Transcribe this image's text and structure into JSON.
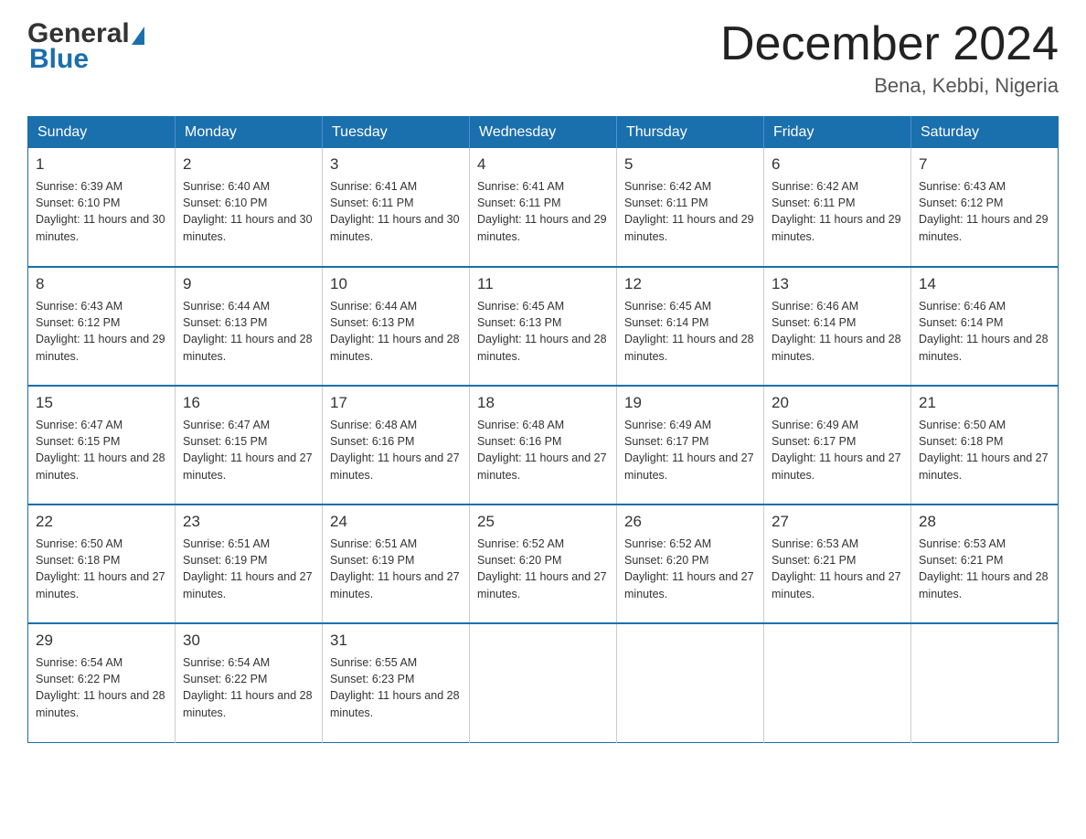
{
  "logo": {
    "general": "General",
    "blue": "Blue",
    "triangle": "▶"
  },
  "header": {
    "title": "December 2024",
    "subtitle": "Bena, Kebbi, Nigeria"
  },
  "weekdays": [
    "Sunday",
    "Monday",
    "Tuesday",
    "Wednesday",
    "Thursday",
    "Friday",
    "Saturday"
  ],
  "weeks": [
    [
      {
        "day": 1,
        "sunrise": "6:39 AM",
        "sunset": "6:10 PM",
        "daylight": "11 hours and 30 minutes."
      },
      {
        "day": 2,
        "sunrise": "6:40 AM",
        "sunset": "6:10 PM",
        "daylight": "11 hours and 30 minutes."
      },
      {
        "day": 3,
        "sunrise": "6:41 AM",
        "sunset": "6:11 PM",
        "daylight": "11 hours and 30 minutes."
      },
      {
        "day": 4,
        "sunrise": "6:41 AM",
        "sunset": "6:11 PM",
        "daylight": "11 hours and 29 minutes."
      },
      {
        "day": 5,
        "sunrise": "6:42 AM",
        "sunset": "6:11 PM",
        "daylight": "11 hours and 29 minutes."
      },
      {
        "day": 6,
        "sunrise": "6:42 AM",
        "sunset": "6:11 PM",
        "daylight": "11 hours and 29 minutes."
      },
      {
        "day": 7,
        "sunrise": "6:43 AM",
        "sunset": "6:12 PM",
        "daylight": "11 hours and 29 minutes."
      }
    ],
    [
      {
        "day": 8,
        "sunrise": "6:43 AM",
        "sunset": "6:12 PM",
        "daylight": "11 hours and 29 minutes."
      },
      {
        "day": 9,
        "sunrise": "6:44 AM",
        "sunset": "6:13 PM",
        "daylight": "11 hours and 28 minutes."
      },
      {
        "day": 10,
        "sunrise": "6:44 AM",
        "sunset": "6:13 PM",
        "daylight": "11 hours and 28 minutes."
      },
      {
        "day": 11,
        "sunrise": "6:45 AM",
        "sunset": "6:13 PM",
        "daylight": "11 hours and 28 minutes."
      },
      {
        "day": 12,
        "sunrise": "6:45 AM",
        "sunset": "6:14 PM",
        "daylight": "11 hours and 28 minutes."
      },
      {
        "day": 13,
        "sunrise": "6:46 AM",
        "sunset": "6:14 PM",
        "daylight": "11 hours and 28 minutes."
      },
      {
        "day": 14,
        "sunrise": "6:46 AM",
        "sunset": "6:14 PM",
        "daylight": "11 hours and 28 minutes."
      }
    ],
    [
      {
        "day": 15,
        "sunrise": "6:47 AM",
        "sunset": "6:15 PM",
        "daylight": "11 hours and 28 minutes."
      },
      {
        "day": 16,
        "sunrise": "6:47 AM",
        "sunset": "6:15 PM",
        "daylight": "11 hours and 27 minutes."
      },
      {
        "day": 17,
        "sunrise": "6:48 AM",
        "sunset": "6:16 PM",
        "daylight": "11 hours and 27 minutes."
      },
      {
        "day": 18,
        "sunrise": "6:48 AM",
        "sunset": "6:16 PM",
        "daylight": "11 hours and 27 minutes."
      },
      {
        "day": 19,
        "sunrise": "6:49 AM",
        "sunset": "6:17 PM",
        "daylight": "11 hours and 27 minutes."
      },
      {
        "day": 20,
        "sunrise": "6:49 AM",
        "sunset": "6:17 PM",
        "daylight": "11 hours and 27 minutes."
      },
      {
        "day": 21,
        "sunrise": "6:50 AM",
        "sunset": "6:18 PM",
        "daylight": "11 hours and 27 minutes."
      }
    ],
    [
      {
        "day": 22,
        "sunrise": "6:50 AM",
        "sunset": "6:18 PM",
        "daylight": "11 hours and 27 minutes."
      },
      {
        "day": 23,
        "sunrise": "6:51 AM",
        "sunset": "6:19 PM",
        "daylight": "11 hours and 27 minutes."
      },
      {
        "day": 24,
        "sunrise": "6:51 AM",
        "sunset": "6:19 PM",
        "daylight": "11 hours and 27 minutes."
      },
      {
        "day": 25,
        "sunrise": "6:52 AM",
        "sunset": "6:20 PM",
        "daylight": "11 hours and 27 minutes."
      },
      {
        "day": 26,
        "sunrise": "6:52 AM",
        "sunset": "6:20 PM",
        "daylight": "11 hours and 27 minutes."
      },
      {
        "day": 27,
        "sunrise": "6:53 AM",
        "sunset": "6:21 PM",
        "daylight": "11 hours and 27 minutes."
      },
      {
        "day": 28,
        "sunrise": "6:53 AM",
        "sunset": "6:21 PM",
        "daylight": "11 hours and 28 minutes."
      }
    ],
    [
      {
        "day": 29,
        "sunrise": "6:54 AM",
        "sunset": "6:22 PM",
        "daylight": "11 hours and 28 minutes."
      },
      {
        "day": 30,
        "sunrise": "6:54 AM",
        "sunset": "6:22 PM",
        "daylight": "11 hours and 28 minutes."
      },
      {
        "day": 31,
        "sunrise": "6:55 AM",
        "sunset": "6:23 PM",
        "daylight": "11 hours and 28 minutes."
      },
      null,
      null,
      null,
      null
    ]
  ]
}
